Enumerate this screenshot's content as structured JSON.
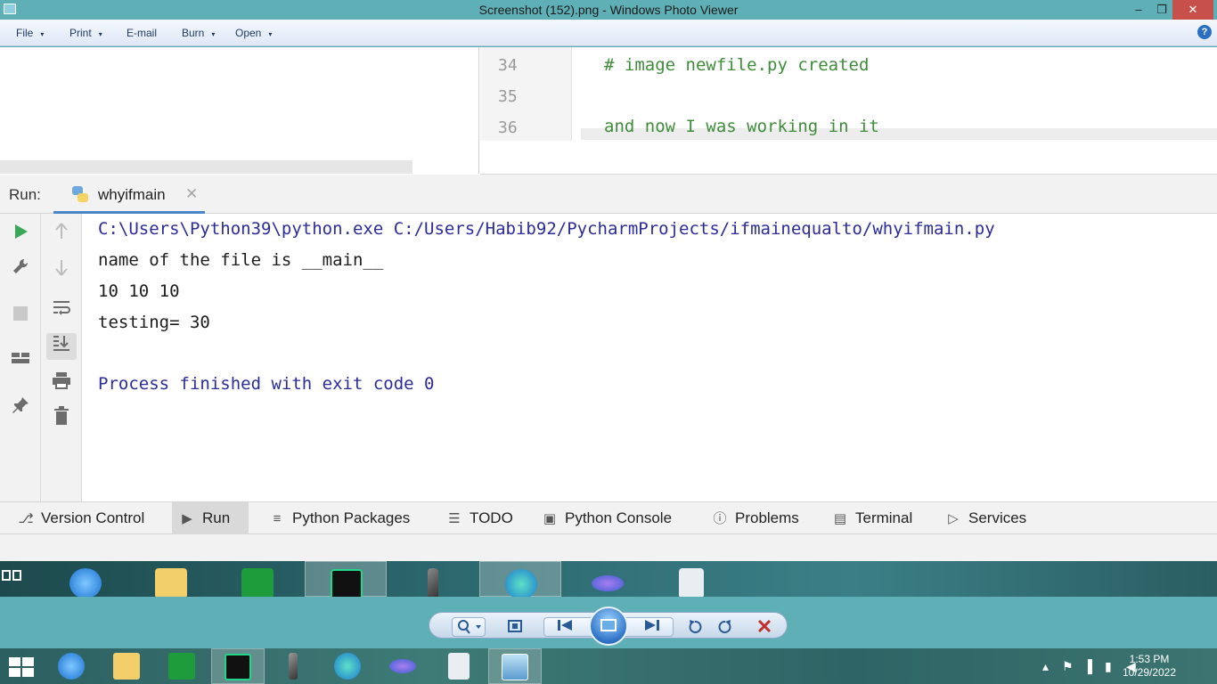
{
  "window": {
    "title": "Screenshot (152).png - Windows Photo Viewer",
    "minimize": "–",
    "maximize": "❐",
    "close": "✕"
  },
  "menu": {
    "file": "File",
    "print": "Print",
    "email": "E-mail",
    "burn": "Burn",
    "open": "Open",
    "arrow": "▾",
    "help": "?"
  },
  "editor": {
    "line_numbers": [
      "34",
      "35",
      "36"
    ],
    "lines": [
      "# image newfile.py created",
      "",
      "and now I was working in it"
    ]
  },
  "run": {
    "label": "Run:",
    "tab_label": "whyifmain",
    "tab_close": "✕"
  },
  "console": {
    "cmd": "C:\\Users\\Python39\\python.exe C:/Users/Habib92/PycharmProjects/ifmainequalto/whyifmain.py",
    "out1": "name of the file is __main__",
    "out2": "10 10 10",
    "out3": "testing= 30",
    "process": "Process finished with exit code 0"
  },
  "tool_tabs": [
    {
      "label": "Version Control",
      "icon": "branch-icon"
    },
    {
      "label": "Run",
      "icon": "play-icon"
    },
    {
      "label": "Python Packages",
      "icon": "layers-icon"
    },
    {
      "label": "TODO",
      "icon": "list-icon"
    },
    {
      "label": "Python Console",
      "icon": "python-icon"
    },
    {
      "label": "Problems",
      "icon": "warning-icon"
    },
    {
      "label": "Terminal",
      "icon": "terminal-icon"
    },
    {
      "label": "Services",
      "icon": "services-icon"
    }
  ],
  "clock": {
    "time": "1:53 PM",
    "date": "10/29/2022"
  },
  "colors": {
    "accent": "#5fb0b6",
    "console_blue": "#2b2b9c",
    "comment_green": "#3f8c3a",
    "close_red": "#c7504a"
  }
}
